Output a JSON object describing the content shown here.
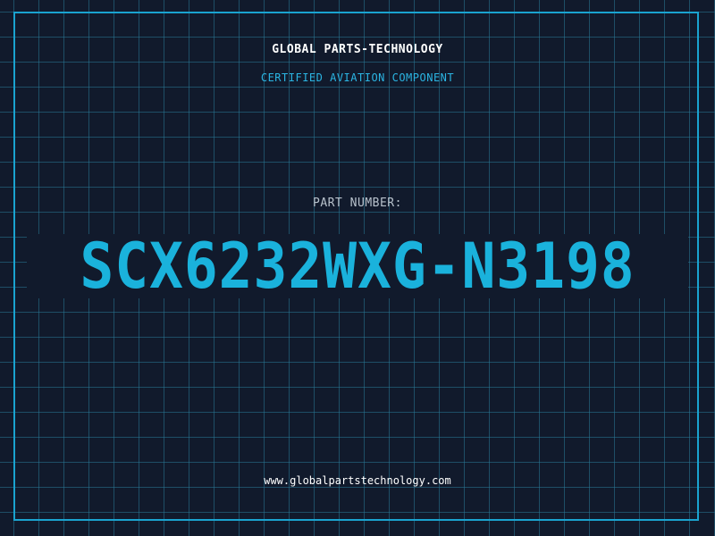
{
  "header": {
    "company": "GLOBAL PARTS-TECHNOLOGY",
    "subtitle": "CERTIFIED AVIATION COMPONENT"
  },
  "part": {
    "label": "PART NUMBER:",
    "number": "SCX6232WXG-N3198"
  },
  "footer": {
    "website": "www.globalpartstechnology.com"
  },
  "colors": {
    "background": "#111a2c",
    "grid": "#287896",
    "accent": "#1ab2dc",
    "text": "#ffffff",
    "label": "#b8c2cc"
  }
}
